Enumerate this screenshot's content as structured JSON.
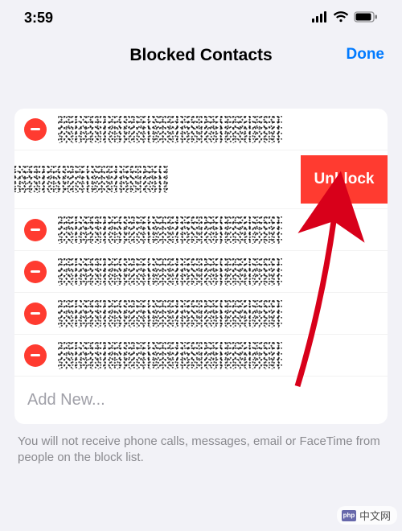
{
  "status": {
    "time": "3:59",
    "signal_icon": "signal-icon",
    "wifi_icon": "wifi-icon",
    "battery_icon": "battery-icon"
  },
  "header": {
    "title": "Blocked Contacts",
    "done_label": "Done"
  },
  "colors": {
    "accent": "#007aff",
    "destructive": "#ff3b30"
  },
  "contacts": {
    "rows": [
      {
        "name_redacted": true
      },
      {
        "name_redacted": true,
        "swiped": true,
        "action_label": "Unblock"
      },
      {
        "name_redacted": true
      },
      {
        "name_redacted": true
      },
      {
        "name_redacted": true
      },
      {
        "name_redacted": true
      }
    ],
    "add_new_label": "Add New..."
  },
  "footer": {
    "note": "You will not receive phone calls, messages, email or FaceTime from people on the block list."
  },
  "watermark": {
    "logo_text": "php",
    "text": "中文网"
  },
  "annotation": {
    "arrow_points_to": "unblock-button"
  }
}
